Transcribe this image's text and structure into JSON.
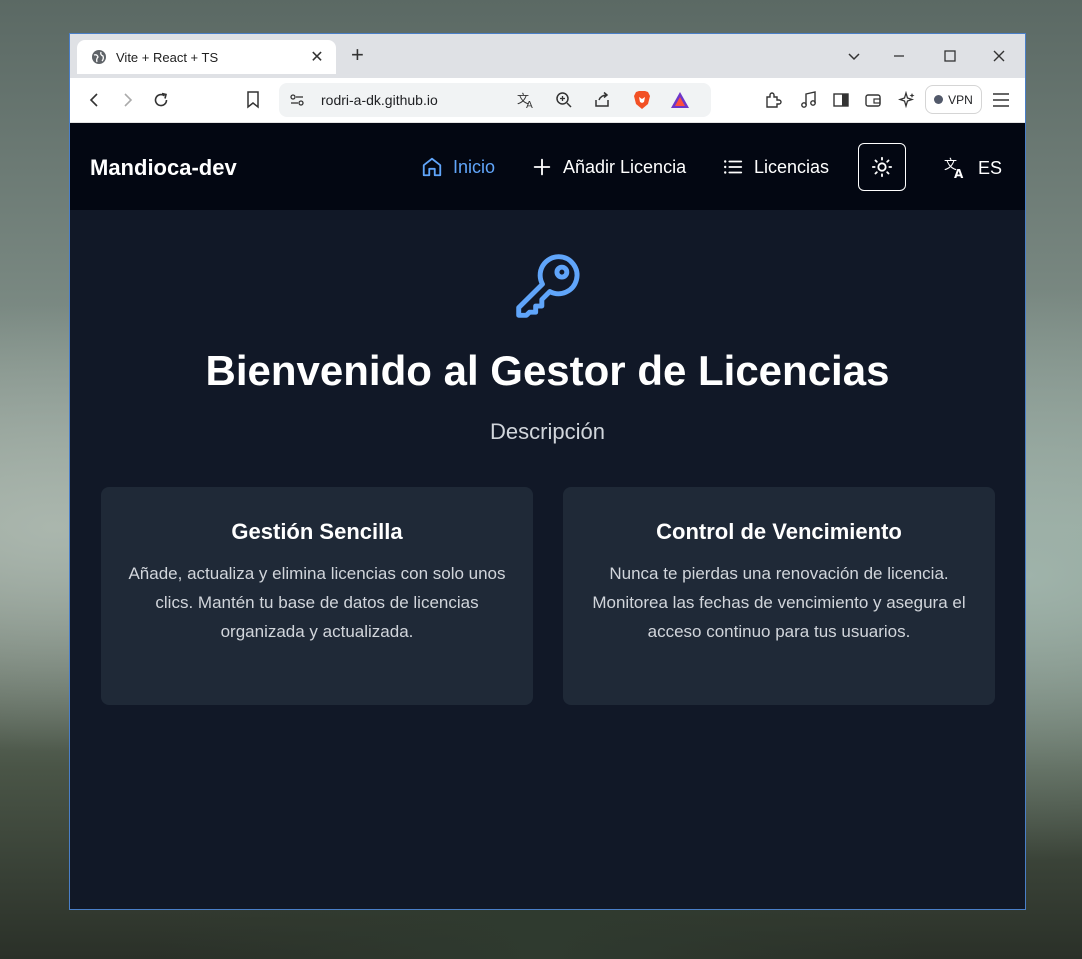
{
  "browser": {
    "tab_title": "Vite + React + TS",
    "new_tab": "+",
    "close_tab": "✕",
    "url": "rodri-a-dk.github.io",
    "vpn_label": "VPN"
  },
  "navbar": {
    "brand": "Mandioca-dev",
    "links": [
      {
        "label": "Inicio",
        "icon": "home-icon",
        "active": true
      },
      {
        "label": "Añadir Licencia",
        "icon": "plus-icon",
        "active": false
      },
      {
        "label": "Licencias",
        "icon": "list-icon",
        "active": false
      }
    ],
    "theme_icon": "sun-icon",
    "language": "ES"
  },
  "hero": {
    "icon": "key-icon",
    "title": "Bienvenido al Gestor de Licencias",
    "description": "Descripción"
  },
  "cards": [
    {
      "title": "Gestión Sencilla",
      "text": "Añade, actualiza y elimina licencias con solo unos clics. Mantén tu base de datos de licencias organizada y actualizada."
    },
    {
      "title": "Control de Vencimiento",
      "text": "Nunca te pierdas una renovación de licencia. Monitorea las fechas de vencimiento y asegura el acceso continuo para tus usuarios."
    }
  ],
  "colors": {
    "accent": "#60a5fa",
    "navbar_bg": "#030712",
    "page_bg": "#111827",
    "card_bg": "#1f2937"
  }
}
